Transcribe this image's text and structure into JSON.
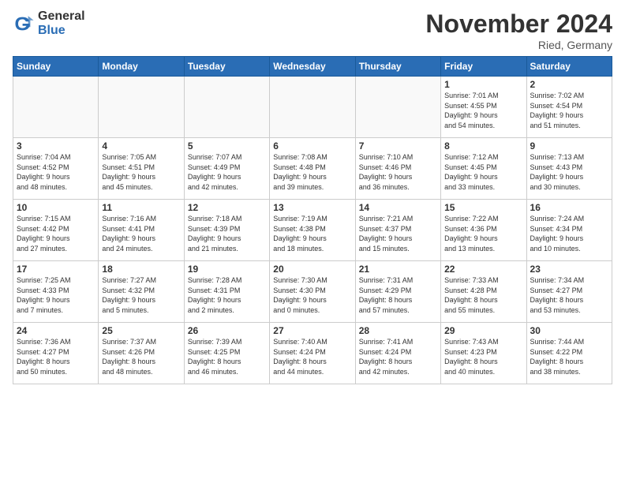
{
  "header": {
    "logo_general": "General",
    "logo_blue": "Blue",
    "month_title": "November 2024",
    "location": "Ried, Germany"
  },
  "weekdays": [
    "Sunday",
    "Monday",
    "Tuesday",
    "Wednesday",
    "Thursday",
    "Friday",
    "Saturday"
  ],
  "weeks": [
    [
      {
        "day": "",
        "info": ""
      },
      {
        "day": "",
        "info": ""
      },
      {
        "day": "",
        "info": ""
      },
      {
        "day": "",
        "info": ""
      },
      {
        "day": "",
        "info": ""
      },
      {
        "day": "1",
        "info": "Sunrise: 7:01 AM\nSunset: 4:55 PM\nDaylight: 9 hours\nand 54 minutes."
      },
      {
        "day": "2",
        "info": "Sunrise: 7:02 AM\nSunset: 4:54 PM\nDaylight: 9 hours\nand 51 minutes."
      }
    ],
    [
      {
        "day": "3",
        "info": "Sunrise: 7:04 AM\nSunset: 4:52 PM\nDaylight: 9 hours\nand 48 minutes."
      },
      {
        "day": "4",
        "info": "Sunrise: 7:05 AM\nSunset: 4:51 PM\nDaylight: 9 hours\nand 45 minutes."
      },
      {
        "day": "5",
        "info": "Sunrise: 7:07 AM\nSunset: 4:49 PM\nDaylight: 9 hours\nand 42 minutes."
      },
      {
        "day": "6",
        "info": "Sunrise: 7:08 AM\nSunset: 4:48 PM\nDaylight: 9 hours\nand 39 minutes."
      },
      {
        "day": "7",
        "info": "Sunrise: 7:10 AM\nSunset: 4:46 PM\nDaylight: 9 hours\nand 36 minutes."
      },
      {
        "day": "8",
        "info": "Sunrise: 7:12 AM\nSunset: 4:45 PM\nDaylight: 9 hours\nand 33 minutes."
      },
      {
        "day": "9",
        "info": "Sunrise: 7:13 AM\nSunset: 4:43 PM\nDaylight: 9 hours\nand 30 minutes."
      }
    ],
    [
      {
        "day": "10",
        "info": "Sunrise: 7:15 AM\nSunset: 4:42 PM\nDaylight: 9 hours\nand 27 minutes."
      },
      {
        "day": "11",
        "info": "Sunrise: 7:16 AM\nSunset: 4:41 PM\nDaylight: 9 hours\nand 24 minutes."
      },
      {
        "day": "12",
        "info": "Sunrise: 7:18 AM\nSunset: 4:39 PM\nDaylight: 9 hours\nand 21 minutes."
      },
      {
        "day": "13",
        "info": "Sunrise: 7:19 AM\nSunset: 4:38 PM\nDaylight: 9 hours\nand 18 minutes."
      },
      {
        "day": "14",
        "info": "Sunrise: 7:21 AM\nSunset: 4:37 PM\nDaylight: 9 hours\nand 15 minutes."
      },
      {
        "day": "15",
        "info": "Sunrise: 7:22 AM\nSunset: 4:36 PM\nDaylight: 9 hours\nand 13 minutes."
      },
      {
        "day": "16",
        "info": "Sunrise: 7:24 AM\nSunset: 4:34 PM\nDaylight: 9 hours\nand 10 minutes."
      }
    ],
    [
      {
        "day": "17",
        "info": "Sunrise: 7:25 AM\nSunset: 4:33 PM\nDaylight: 9 hours\nand 7 minutes."
      },
      {
        "day": "18",
        "info": "Sunrise: 7:27 AM\nSunset: 4:32 PM\nDaylight: 9 hours\nand 5 minutes."
      },
      {
        "day": "19",
        "info": "Sunrise: 7:28 AM\nSunset: 4:31 PM\nDaylight: 9 hours\nand 2 minutes."
      },
      {
        "day": "20",
        "info": "Sunrise: 7:30 AM\nSunset: 4:30 PM\nDaylight: 9 hours\nand 0 minutes."
      },
      {
        "day": "21",
        "info": "Sunrise: 7:31 AM\nSunset: 4:29 PM\nDaylight: 8 hours\nand 57 minutes."
      },
      {
        "day": "22",
        "info": "Sunrise: 7:33 AM\nSunset: 4:28 PM\nDaylight: 8 hours\nand 55 minutes."
      },
      {
        "day": "23",
        "info": "Sunrise: 7:34 AM\nSunset: 4:27 PM\nDaylight: 8 hours\nand 53 minutes."
      }
    ],
    [
      {
        "day": "24",
        "info": "Sunrise: 7:36 AM\nSunset: 4:27 PM\nDaylight: 8 hours\nand 50 minutes."
      },
      {
        "day": "25",
        "info": "Sunrise: 7:37 AM\nSunset: 4:26 PM\nDaylight: 8 hours\nand 48 minutes."
      },
      {
        "day": "26",
        "info": "Sunrise: 7:39 AM\nSunset: 4:25 PM\nDaylight: 8 hours\nand 46 minutes."
      },
      {
        "day": "27",
        "info": "Sunrise: 7:40 AM\nSunset: 4:24 PM\nDaylight: 8 hours\nand 44 minutes."
      },
      {
        "day": "28",
        "info": "Sunrise: 7:41 AM\nSunset: 4:24 PM\nDaylight: 8 hours\nand 42 minutes."
      },
      {
        "day": "29",
        "info": "Sunrise: 7:43 AM\nSunset: 4:23 PM\nDaylight: 8 hours\nand 40 minutes."
      },
      {
        "day": "30",
        "info": "Sunrise: 7:44 AM\nSunset: 4:22 PM\nDaylight: 8 hours\nand 38 minutes."
      }
    ]
  ]
}
